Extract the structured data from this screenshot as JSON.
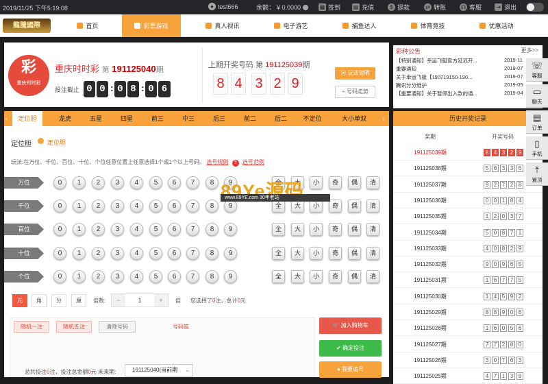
{
  "topbar": {
    "datetime": "2019/11/25 下午5:19:08",
    "user": "test666",
    "balance_label": "余额：",
    "balance": "¥ 0.0000",
    "items": [
      {
        "icon": "calendar-icon",
        "label": "签到"
      },
      {
        "icon": "deposit-icon",
        "label": "充值"
      },
      {
        "icon": "withdraw-icon",
        "label": "提款"
      },
      {
        "icon": "transfer-icon",
        "label": "转账"
      },
      {
        "icon": "headset-icon",
        "label": "客服"
      },
      {
        "icon": "logout-icon",
        "label": "退出"
      }
    ]
  },
  "nav": {
    "logo_text": "龍騰國際",
    "items": [
      "首页",
      "彩票游戏",
      "真人视讯",
      "电子游艺",
      "捕鱼达人",
      "体育竞技",
      "优惠活动"
    ],
    "active": "彩票游戏"
  },
  "lottery": {
    "icon_text": "重庆时时彩",
    "name": "重庆时时彩",
    "issue_prefix": "第",
    "issue": "191125040",
    "issue_suffix": "期",
    "countdown_label": "投注截止",
    "countdown": [
      "0",
      "0",
      "0",
      "8",
      "0",
      "6"
    ],
    "last_label": "上期开奖号码 第",
    "last_issue": "191125039",
    "last_suffix": "期",
    "last_numbers": [
      "8",
      "4",
      "3",
      "2",
      "9"
    ],
    "rules_btn": "玩法说明",
    "trend_btn": "号码走势"
  },
  "notices": {
    "title": "彩种公告",
    "more": "更多>>",
    "items": [
      {
        "text": "【特别通知】幸运飞艇官方延迟开...",
        "date": "2019-11"
      },
      {
        "text": "重要通知",
        "date": "2019-07"
      },
      {
        "text": "关于幸运飞艇【190719150-190...",
        "date": "2019-07"
      },
      {
        "text": "腾讯分分维护",
        "date": "2019-05"
      },
      {
        "text": "【重要通知】关于暂停出入款的通...",
        "date": "2019-04"
      }
    ]
  },
  "tabs": [
    "定位胆",
    "龙虎",
    "五星",
    "四星",
    "前三",
    "中三",
    "后三",
    "前二",
    "后二",
    "不定位",
    "大小单双"
  ],
  "play": {
    "title": "定位胆",
    "option": "定位胆",
    "desc": "玩法:在万位、千位、百位、十位、个位任意位置上任意选择1个或1个以上号码。",
    "rule_link": "选号规则",
    "example_link": "选号范例",
    "rows": [
      "万位",
      "千位",
      "百位",
      "十位",
      "个位"
    ],
    "digits": [
      "0",
      "1",
      "2",
      "3",
      "4",
      "5",
      "6",
      "7",
      "8",
      "9"
    ],
    "filters": [
      "全",
      "大",
      "小",
      "奇",
      "偶",
      "清"
    ]
  },
  "bet": {
    "units": [
      "元",
      "角",
      "分",
      "厘"
    ],
    "multiple_label": "倍数:",
    "minus": "−",
    "multiple": "1",
    "plus": "+",
    "times_unit": "倍",
    "selected_text": "您选择了",
    "selected_count": "0",
    "selected_unit": "注，总计",
    "total": "0",
    "total_unit": "元",
    "random1": "随机一注",
    "random5": "随机五注",
    "clear": "清除号码",
    "basket_label": "号码篮",
    "summary": "总共投注",
    "summary_count": "0",
    "summary_mid": "注，投注总金额",
    "summary_amount": "0",
    "summary_tail": "元 未来期:",
    "future_issue": "191125040(当前期",
    "add_cart": "加入购物车",
    "confirm": "确定投注",
    "chase": "我要追号"
  },
  "history": {
    "title": "历史开奖记录",
    "col_issue": "奖期",
    "col_nums": "开奖号码",
    "rows": [
      {
        "issue": "191125039期",
        "nums": [
          "8",
          "4",
          "3",
          "2",
          "9"
        ],
        "highlight": true
      },
      {
        "issue": "191125038期",
        "nums": [
          "5",
          "6",
          "3",
          "3",
          "6"
        ]
      },
      {
        "issue": "191125037期",
        "nums": [
          "9",
          "2",
          "7",
          "2",
          "8"
        ]
      },
      {
        "issue": "191125036期",
        "nums": [
          "0",
          "0",
          "1",
          "8",
          "4"
        ]
      },
      {
        "issue": "191125035期",
        "nums": [
          "1",
          "2",
          "0",
          "3",
          "7"
        ]
      },
      {
        "issue": "191125034期",
        "nums": [
          "5",
          "0",
          "8",
          "7",
          "1"
        ]
      },
      {
        "issue": "191125033期",
        "nums": [
          "4",
          "0",
          "8",
          "2",
          "9"
        ]
      },
      {
        "issue": "191125032期",
        "nums": [
          "9",
          "0",
          "9",
          "6",
          "5"
        ]
      },
      {
        "issue": "191125031期",
        "nums": [
          "1",
          "6",
          "7",
          "7",
          "5"
        ]
      },
      {
        "issue": "191125030期",
        "nums": [
          "1",
          "4",
          "5",
          "9",
          "2"
        ]
      },
      {
        "issue": "191125029期",
        "nums": [
          "8",
          "8",
          "9",
          "0",
          "6"
        ]
      },
      {
        "issue": "191125028期",
        "nums": [
          "1",
          "6",
          "0",
          "5",
          "6"
        ]
      },
      {
        "issue": "191125027期",
        "nums": [
          "7",
          "7",
          "2",
          "8",
          "0"
        ]
      },
      {
        "issue": "191125026期",
        "nums": [
          "3",
          "0",
          "7",
          "6",
          "3"
        ]
      },
      {
        "issue": "191125025期",
        "nums": [
          "4",
          "7",
          "1",
          "3",
          "9"
        ]
      }
    ]
  },
  "rightbar": [
    {
      "icon": "chat-icon",
      "label": "客服"
    },
    {
      "icon": "message-icon",
      "label": "聊天"
    },
    {
      "icon": "clipboard-icon",
      "label": "订单"
    },
    {
      "icon": "phone-icon",
      "label": "手机"
    },
    {
      "icon": "arrow-up-icon",
      "label": "置顶"
    }
  ],
  "watermark": {
    "main": "89Ye源码",
    "sub": "www.89YE.com  30年老站"
  }
}
